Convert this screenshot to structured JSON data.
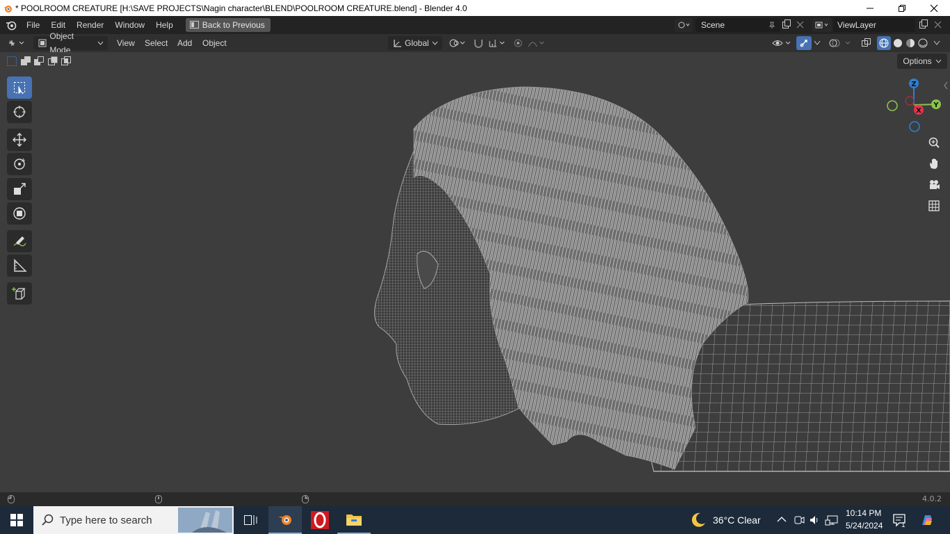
{
  "window": {
    "title": "* POOLROOM CREATURE [H:\\SAVE PROJECTS\\Nagin character\\BLEND\\POOLROOM CREATURE.blend] - Blender 4.0"
  },
  "topbar": {
    "menus": [
      "File",
      "Edit",
      "Render",
      "Window",
      "Help"
    ],
    "back_label": "Back to Previous",
    "scene_value": "Scene",
    "viewlayer_value": "ViewLayer"
  },
  "viewport_header": {
    "mode": "Object Mode",
    "menus": [
      "View",
      "Select",
      "Add",
      "Object"
    ],
    "transform_orientation": "Global",
    "options_label": "Options"
  },
  "gizmo": {
    "z": "Z",
    "y": "Y",
    "x": "X"
  },
  "status": {
    "version": "4.0.2"
  },
  "taskbar": {
    "search_placeholder": "Type here to search",
    "weather": "36°C  Clear",
    "time": "10:14 PM",
    "date": "5/24/2024",
    "notification_count": "1"
  },
  "colors": {
    "accent_blue": "#4772b3",
    "axis_x": "#e8324a",
    "axis_y": "#8bc34a",
    "axis_z": "#2f7fd1"
  }
}
